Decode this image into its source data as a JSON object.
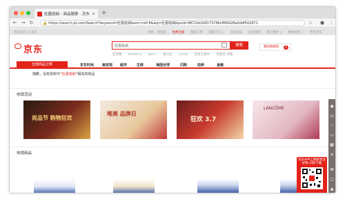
{
  "browser": {
    "tab_title": "杜嘉班纳 - 商品搜索 - 京东",
    "tab_close": "×",
    "new_tab": "+",
    "url": "https://search.jd.com/Search?keyword=杜嘉班纳&enc=utf-8&wq=杜嘉班纳&pvid=8672dc0df173746c895628a0ddf502671",
    "lock": "🔒",
    "back": "←",
    "forward": "→",
    "reload": "↻",
    "traffic_colors": [
      "#ff5f57",
      "#febc2e",
      "#28c840"
    ]
  },
  "topbar": {
    "location": "京东首页  ⊙ 北京",
    "links": [
      "你好，请登录",
      "免费注册",
      "我的订单",
      "我的京东 ∨",
      "京东会员",
      "企业采购",
      "客户服务 ∨",
      "网站导航 ∨",
      "手机京东"
    ]
  },
  "header": {
    "logo": "京东",
    "search_value": "杜嘉班纳",
    "search_button": "搜索",
    "hotwords": [
      "匹诺曹",
      "burberry",
      "gucci",
      "爱马仕",
      "prada",
      "范思哲香水",
      "范思哲 男香"
    ],
    "cart_label": "我的购物车",
    "cart_count": "0"
  },
  "nav": {
    "all_categories": "全部商品分类",
    "items": [
      "京东时尚",
      "美妆馆",
      "超市",
      "生鲜",
      "海囤全球",
      "闪购",
      "拍卖",
      "金融"
    ]
  },
  "notice": {
    "prefix": "抱歉，没有找到与“",
    "keyword": "杜嘉班纳",
    "suffix": "”相关的商品"
  },
  "sections": {
    "hot_activities": "热销活动",
    "hot_products": "热销商品"
  },
  "banners": [
    {
      "text": "尚品节 购物狂欢",
      "colors": [
        "#2a1a12",
        "#7a2b1d",
        "#d9a441"
      ]
    },
    {
      "text": "唯美 品牌日",
      "colors": [
        "#f3eadf",
        "#e7c79b",
        "#c23a3a"
      ]
    },
    {
      "text": "狂欢 3.7",
      "colors": [
        "#6b1e1e",
        "#c83a2e",
        "#f2d6a8"
      ]
    },
    {
      "text": "LANCÔME",
      "colors": [
        "#f7e6ea",
        "#e3b8c2",
        "#b03a55"
      ]
    }
  ],
  "rail_icons": [
    "user-icon",
    "cart-icon",
    "heart-icon",
    "message-icon",
    "calendar-icon",
    "layers-icon",
    "scan-icon",
    "chat-icon",
    "top-icon"
  ],
  "qr": {
    "text": "京东APP上探索更多好物 扫码下载"
  }
}
